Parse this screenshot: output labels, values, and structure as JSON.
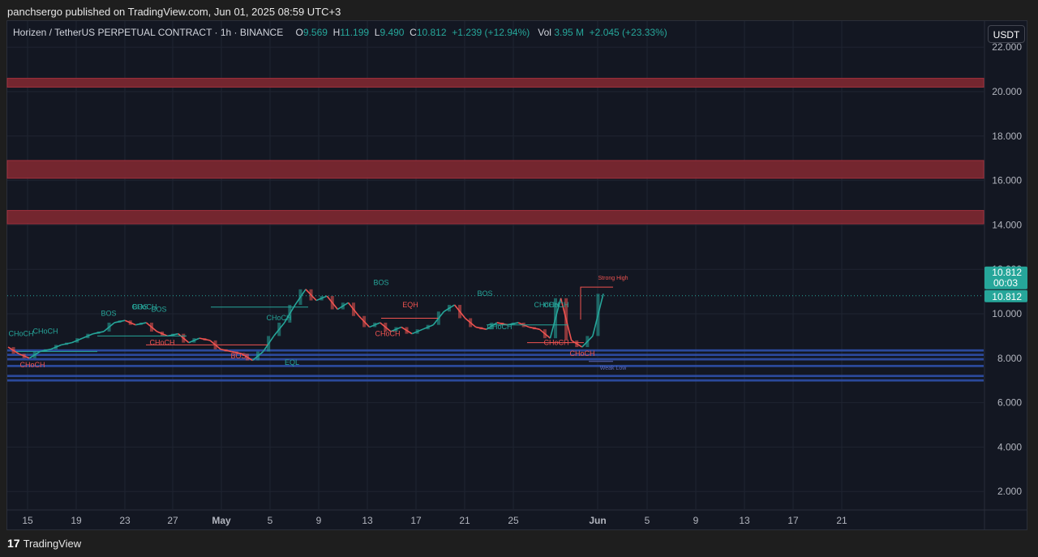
{
  "header": {
    "published": "panchsergo published on TradingView.com, Jun 01, 2025 08:59 UTC+3"
  },
  "legend": {
    "symbol": "Horizen / TetherUS PERPETUAL CONTRACT · 1h · BINANCE",
    "o_label": "O",
    "o_value": "9.569",
    "h_label": "H",
    "h_value": "11.199",
    "l_label": "L",
    "l_value": "9.490",
    "c_label": "C",
    "c_value": "10.812",
    "change": "+1.239 (+12.94%)",
    "vol_label": "Vol",
    "vol_value": "3.95 M",
    "vol_change": "+2.045 (+23.33%)"
  },
  "currency_button": "USDT",
  "footer": {
    "brand": "TradingView",
    "mark": "17"
  },
  "chart_data": {
    "type": "candlestick",
    "title": "Horizen / TetherUS PERPETUAL CONTRACT · 1h · BINANCE",
    "y_axis": {
      "ylim": [
        1.2,
        22.3
      ],
      "ticks": [
        "2.000",
        "4.000",
        "6.000",
        "8.000",
        "10.000",
        "12.000",
        "14.000",
        "16.000",
        "18.000",
        "20.000",
        "22.000"
      ],
      "tick_values": [
        2,
        4,
        6,
        8,
        10,
        12,
        14,
        16,
        18,
        20,
        22
      ]
    },
    "x_axis": {
      "ticks": [
        "15",
        "19",
        "23",
        "27",
        "May",
        "5",
        "9",
        "13",
        "17",
        "21",
        "25",
        "Jun",
        "5",
        "9",
        "13",
        "17",
        "21"
      ]
    },
    "grid": true,
    "colors": {
      "up": "#26a69a",
      "down": "#ef5350",
      "supply_zone": "#7a2730",
      "demand_zone": "#2f4fa8"
    },
    "last_price": {
      "value": 10.812,
      "label": "10.812",
      "countdown": "00:03",
      "label2": "10.812"
    },
    "supply_zones": [
      {
        "low": 20.2,
        "high": 20.6
      },
      {
        "low": 16.1,
        "high": 16.9
      },
      {
        "low": 14.05,
        "high": 14.65
      }
    ],
    "demand_zones": [
      {
        "low": 8.3,
        "high": 8.4
      },
      {
        "low": 8.1,
        "high": 8.2
      },
      {
        "low": 7.9,
        "high": 8.0
      },
      {
        "low": 7.6,
        "high": 7.7
      },
      {
        "low": 7.15,
        "high": 7.25
      },
      {
        "low": 6.95,
        "high": 7.05
      }
    ],
    "price_path": [
      8.5,
      8.2,
      8.0,
      8.3,
      8.4,
      8.6,
      8.7,
      8.9,
      9.1,
      9.2,
      9.6,
      9.7,
      9.5,
      9.6,
      9.2,
      9.0,
      9.1,
      8.7,
      8.9,
      8.8,
      8.4,
      8.3,
      8.2,
      7.9,
      8.3,
      9.0,
      9.6,
      10.4,
      11.1,
      10.6,
      10.8,
      10.2,
      10.5,
      9.9,
      9.4,
      9.6,
      9.2,
      9.4,
      9.1,
      9.3,
      9.5,
      10.1,
      10.4,
      9.8,
      9.4,
      9.3,
      9.6,
      9.5,
      9.6,
      9.4,
      9.3,
      8.9,
      10.7,
      8.8,
      8.5,
      9.0,
      10.9
    ],
    "strong_high": {
      "value": 11.2,
      "label": "Strong High"
    },
    "weak_low": {
      "value": 8.0,
      "label": "Weak Low"
    },
    "annotations": [
      {
        "text": "CHoCH",
        "color": "#26a69a",
        "v": 9.0
      },
      {
        "text": "CHoCH",
        "color": "#26a69a",
        "v": 9.1
      },
      {
        "text": "CHoCH",
        "color": "#ef5350",
        "v": 7.6
      },
      {
        "text": "BOS",
        "color": "#26a69a",
        "v": 9.9
      },
      {
        "text": "BOS",
        "color": "#26a69a",
        "v": 10.2
      },
      {
        "text": "CHoCH",
        "color": "#26a69a",
        "v": 10.2
      },
      {
        "text": "BOS",
        "color": "#26a69a",
        "v": 10.1
      },
      {
        "text": "CHoCH",
        "color": "#ef5350",
        "v": 8.6
      },
      {
        "text": "BOS",
        "color": "#ef5350",
        "v": 8.0
      },
      {
        "text": "CHoCH",
        "color": "#26a69a",
        "v": 9.7
      },
      {
        "text": "EQL",
        "color": "#26a69a",
        "v": 7.7
      },
      {
        "text": "BOS",
        "color": "#26a69a",
        "v": 11.3
      },
      {
        "text": "CHoCH",
        "color": "#ef5350",
        "v": 9.0
      },
      {
        "text": "EQH",
        "color": "#ef5350",
        "v": 10.3
      },
      {
        "text": "CHoCH",
        "color": "#26a69a",
        "v": 10.3
      },
      {
        "text": "BOS",
        "color": "#26a69a",
        "v": 10.8
      },
      {
        "text": "CHoCH",
        "color": "#26a69a",
        "v": 9.3
      },
      {
        "text": "CHoCH",
        "color": "#26a69a",
        "v": 10.3
      },
      {
        "text": "CHoCH",
        "color": "#ef5350",
        "v": 8.6
      },
      {
        "text": "CHoCH",
        "color": "#ef5350",
        "v": 8.1
      }
    ]
  }
}
